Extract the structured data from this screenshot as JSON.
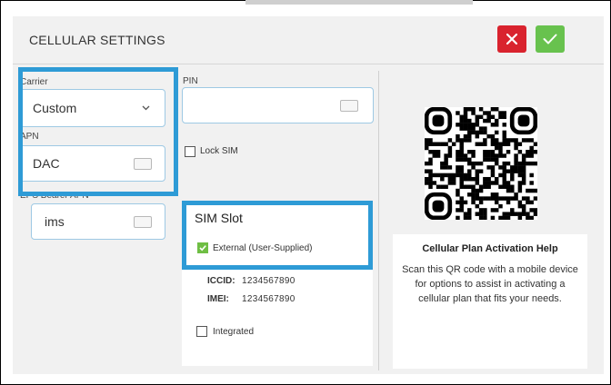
{
  "dialog": {
    "title": "CELLULAR SETTINGS",
    "cancel_icon": "close-icon",
    "confirm_icon": "check-icon"
  },
  "carrier": {
    "label": "Carrier",
    "value": "Custom"
  },
  "apn": {
    "label": "APN",
    "value": "DAC"
  },
  "eps_bearer_apn": {
    "label": "EPS Bearer APN",
    "value": "ims"
  },
  "pin": {
    "label": "PIN",
    "value": ""
  },
  "lock_sim": {
    "label": "Lock SIM",
    "checked": false
  },
  "sim_slot": {
    "title": "SIM Slot",
    "external": {
      "label": "External (User-Supplied)",
      "checked": true
    },
    "iccid_label": "ICCID:",
    "iccid_value": "1234567890",
    "imei_label": "IMEI:",
    "imei_value": "1234567890",
    "integrated": {
      "label": "Integrated",
      "checked": false
    }
  },
  "help": {
    "title": "Cellular Plan Activation Help",
    "text": "Scan this QR code with a mobile device for options to assist in activating a cellular plan that fits your needs."
  },
  "colors": {
    "highlight": "#2e9bd6",
    "cancel": "#d9232e",
    "confirm": "#68c24e",
    "field_border": "#9ec9e4"
  }
}
